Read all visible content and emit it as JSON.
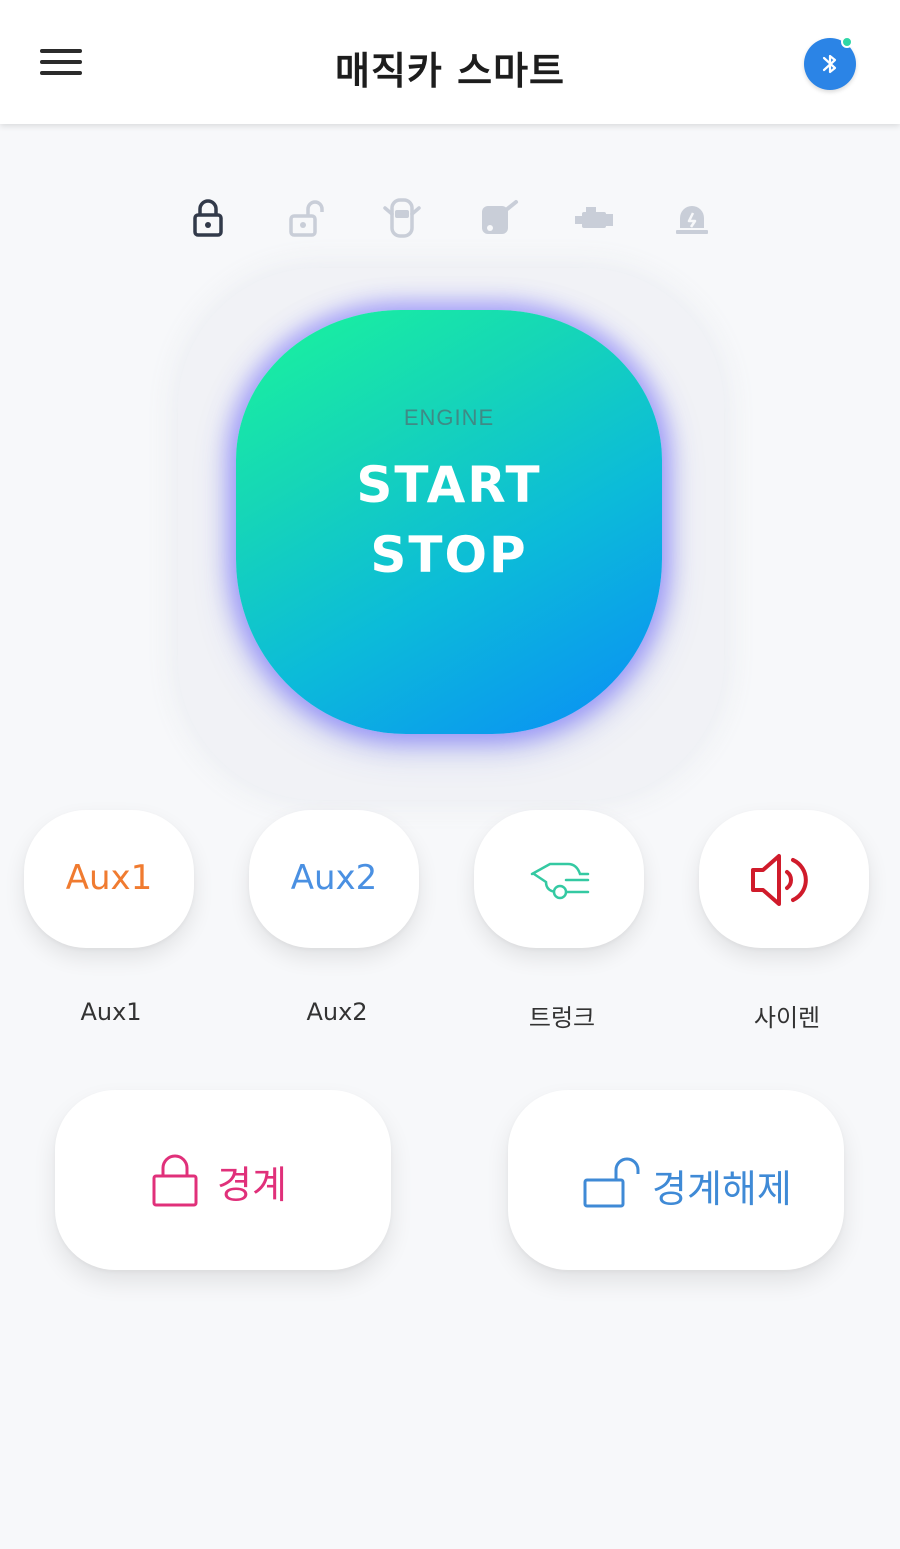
{
  "header": {
    "title": "매직카 스마트"
  },
  "engine": {
    "label": "ENGINE",
    "line1": "START",
    "line2": "STOP"
  },
  "status_icons": [
    {
      "name": "lock",
      "active": true
    },
    {
      "name": "unlock",
      "active": false
    },
    {
      "name": "door",
      "active": false
    },
    {
      "name": "trunk",
      "active": false
    },
    {
      "name": "engine",
      "active": false
    },
    {
      "name": "alarm",
      "active": false
    }
  ],
  "buttons": {
    "aux1": {
      "text": "Aux1",
      "label": "Aux1",
      "color": "#f07b30"
    },
    "aux2": {
      "text": "Aux2",
      "label": "Aux2",
      "color": "#4a90e2"
    },
    "trunk": {
      "label": "트렁크",
      "icon": "trunk-icon",
      "color": "#34c9a2"
    },
    "siren": {
      "label": "사이렌",
      "icon": "speaker-icon",
      "color": "#d01b2b"
    }
  },
  "arm": {
    "label": "경계",
    "color": "#e0307a"
  },
  "disarm": {
    "label": "경계해제",
    "color": "#3f8ad6"
  },
  "colors": {
    "accent_bluetooth": "#2b84e6",
    "status_active": "#323a4a",
    "status_inactive": "#c9ced8"
  }
}
